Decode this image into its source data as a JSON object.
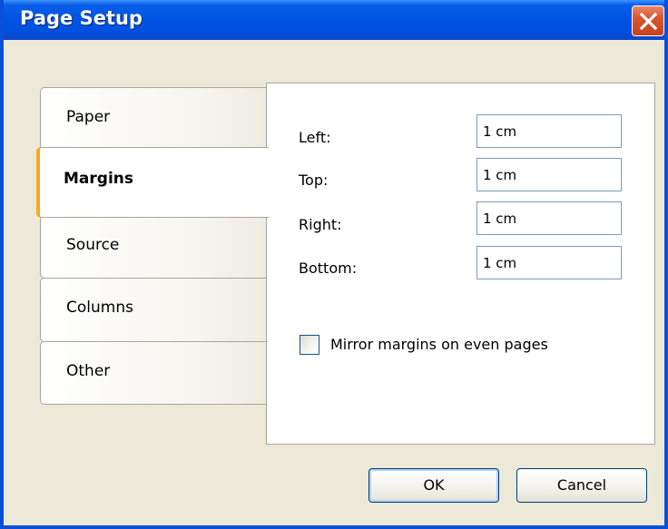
{
  "window": {
    "title": "Page Setup",
    "close_icon": "close-icon"
  },
  "tabs": [
    {
      "label": "Paper",
      "active": false
    },
    {
      "label": "Margins",
      "active": true
    },
    {
      "label": "Source",
      "active": false
    },
    {
      "label": "Columns",
      "active": false
    },
    {
      "label": "Other",
      "active": false
    }
  ],
  "margins": {
    "left_label": "Left:",
    "left_value": "1 cm",
    "top_label": "Top:",
    "top_value": "1 cm",
    "right_label": "Right:",
    "right_value": "1 cm",
    "bottom_label": "Bottom:",
    "bottom_value": "1 cm",
    "mirror_label": "Mirror margins on even pages",
    "mirror_checked": false
  },
  "buttons": {
    "ok_label": "OK",
    "cancel_label": "Cancel"
  },
  "colors": {
    "titlebar": "#0054E3",
    "active_tab_accent": "#F8A822",
    "dialog_background": "#ECE9D8"
  }
}
